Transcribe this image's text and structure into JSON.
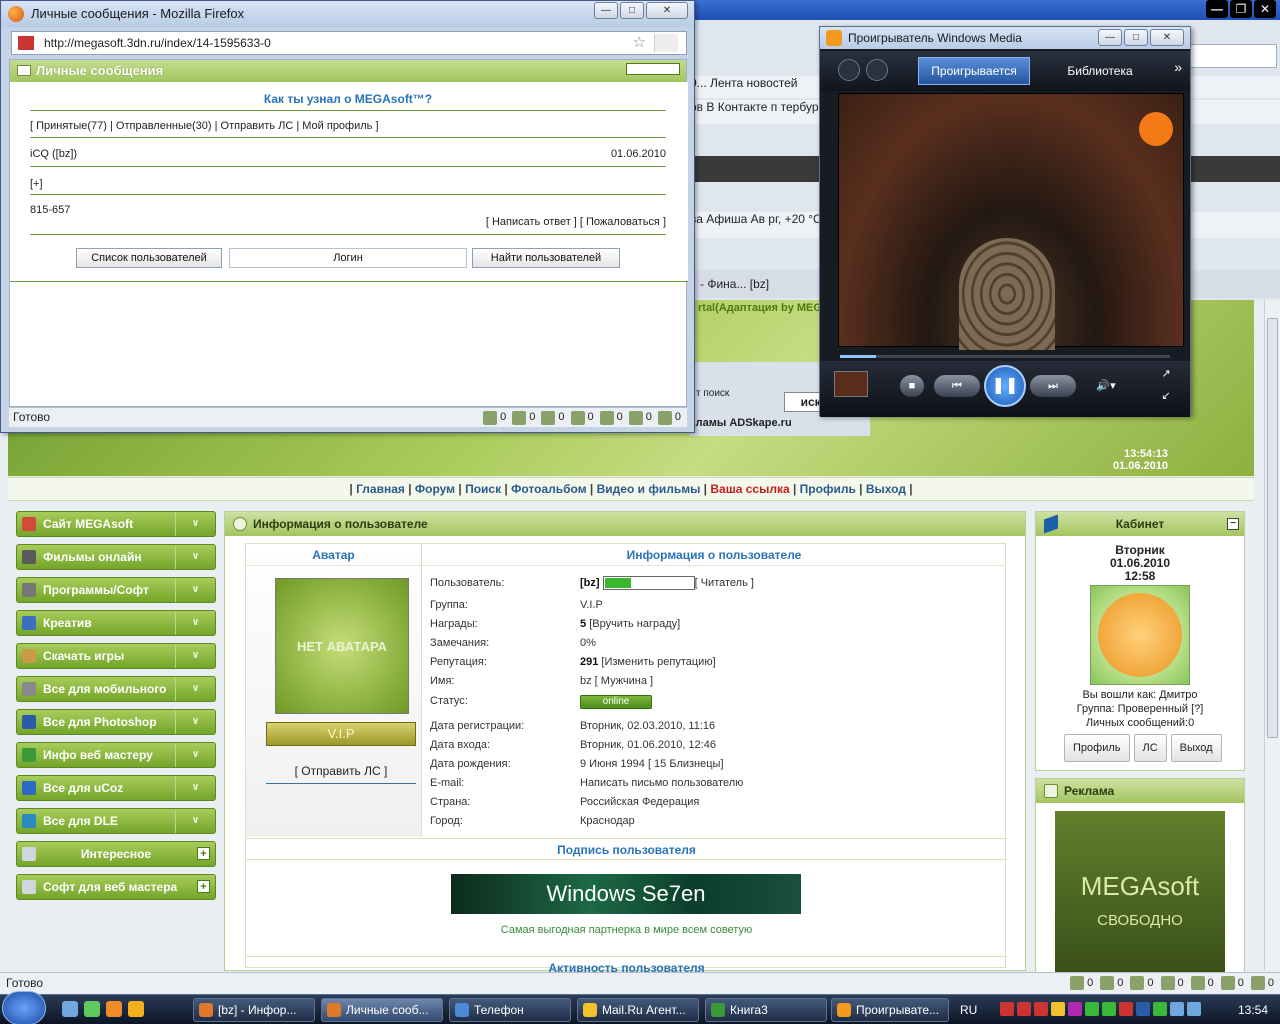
{
  "background_browser": {
    "bookmarks_row1": "0... Лента новостей",
    "bookmarks_row2": "ов  В Контакте   п                                                           тербург  +20",
    "bookmarks_row3": "ва  Афиша  Ав                                                            рг, +20 °C",
    "tab_label": "- Фина...  [bz]",
    "site_tagline": "rtal(Адаптация by MEG",
    "search_label": "т поиск",
    "search_button": "иска",
    "ad_label": "кламы ADSkape.ru",
    "clock_time": "13:54:13",
    "clock_date": "01.06.2010",
    "status": "Готово",
    "status_counts": [
      "0",
      "0",
      "0",
      "0",
      "0",
      "0",
      "0"
    ]
  },
  "nav": {
    "items": [
      "Главная",
      "Форум",
      "Поиск",
      "Фотоальбом",
      "Видео и фильмы",
      "Ваша ссылка",
      "Профиль",
      "Выход"
    ]
  },
  "left_menu": [
    {
      "label": "Сайт MEGAsoft",
      "color": "#d44a3a"
    },
    {
      "label": "Фильмы онлайн",
      "color": "#5a5a5a"
    },
    {
      "label": "Программы/Софт",
      "color": "#777777"
    },
    {
      "label": "Креатив",
      "color": "#3a6fc2"
    },
    {
      "label": "Скачать игры",
      "color": "#c89b47"
    },
    {
      "label": "Все для мобильного",
      "color": "#8a8a8a"
    },
    {
      "label": "Все для Photoshop",
      "color": "#2a5da8"
    },
    {
      "label": "Инфо веб мастеру",
      "color": "#3a9a3a"
    },
    {
      "label": "Все для uCoz",
      "color": "#2a6ac2"
    },
    {
      "label": "Все для DLE",
      "color": "#2a8ac2"
    }
  ],
  "left_menu_expand": [
    {
      "label": "Интересное"
    },
    {
      "label": "Софт для веб мастера"
    }
  ],
  "profile": {
    "panel_title": "Информация о пользователе",
    "avatar_title": "Аватар",
    "info_title": "Информация о пользователе",
    "avatar_text": "НЕТ АВАТАРА",
    "vip_badge": "V.I.P",
    "send_pm": "[ Отправить ЛС ]",
    "rows": [
      {
        "k": "Пользователь:",
        "v": "[bz]",
        "extra": "[ Читатель ]",
        "reputation_fill": 0.3
      },
      {
        "k": "Группа:",
        "v": "V.I.P"
      },
      {
        "k": "Награды:",
        "v": "5",
        "extra": "[Вручить награду]"
      },
      {
        "k": "Замечания:",
        "v": "0%"
      },
      {
        "k": "Репутация:",
        "v": "291",
        "extra": "[Изменить репутацию]"
      },
      {
        "k": "Имя:",
        "v": "bz [ Мужчина ]"
      },
      {
        "k": "Статус:",
        "v": "online"
      },
      {
        "k": "Дата регистрации:",
        "v": "Вторник, 02.03.2010, 11:16"
      },
      {
        "k": "Дата входа:",
        "v": "Вторник, 01.06.2010, 12:46"
      },
      {
        "k": "Дата рождения:",
        "v": "9 Июня 1994 [ 15 Близнецы]"
      },
      {
        "k": "E-mail:",
        "v": "Написать письмо пользователю"
      },
      {
        "k": "Страна:",
        "v": "Российская Федерация"
      },
      {
        "k": "Город:",
        "v": "Краснодар"
      }
    ],
    "signature_title": "Подпись пользователя",
    "signature_banner": "Windows Se7en",
    "signature_text": "Самая выгодная партнерка в мире всем советую",
    "activity_title": "Активность пользователя"
  },
  "cabinet": {
    "title": "Кабинет",
    "day": "Вторник",
    "date": "01.06.2010",
    "time": "12:58",
    "logged_as": "Вы вошли как: Дмитро",
    "group": "Группа: Проверенный  [?]",
    "messages": "Личных сообщений:0",
    "buttons": [
      "Профиль",
      "ЛС",
      "Выход"
    ]
  },
  "ads": {
    "title": "Реклама",
    "brand": "MEGAsoft",
    "slogan": "СВОБОДНО"
  },
  "firefox_popup": {
    "title": "Личные сообщения - Mozilla Firefox",
    "url": "http://megasoft.3dn.ru/index/14-1595633-0",
    "panel_title": "Личные сообщения",
    "subject": "Как ты узнал о MEGAsoft™?",
    "links": "[ Принятые(77) | Отправленные(30) | Отправить ЛС | Мой профиль ]",
    "sender": "iCQ   ([bz])",
    "date": "01.06.2010",
    "expand": "[+]",
    "message": "815-657",
    "actions": "[ Написать ответ ] [ Пожаловаться ]",
    "btn_users": "Список пользователей",
    "login_placeholder": "Логин",
    "btn_find": "Найти пользователей",
    "status": "Готово",
    "status_counts": [
      "0",
      "0",
      "0",
      "0",
      "0",
      "0",
      "0"
    ]
  },
  "wmp": {
    "title": "Проигрыватель Windows Media",
    "tab_playing": "Проигрывается",
    "tab_library": "Библиотека",
    "progress": 0.11
  },
  "taskbar": {
    "tasks": [
      {
        "label": "[bz] - Инфор...",
        "color": "#e07a2a"
      },
      {
        "label": "Личные сооб...",
        "color": "#e07a2a"
      },
      {
        "label": "Телефон",
        "color": "#4a8ad8"
      },
      {
        "label": "Mail.Ru Агент...",
        "color": "#f2c12e"
      },
      {
        "label": "Книга3",
        "color": "#3a9a3a"
      },
      {
        "label": "Проигрывате...",
        "color": "#f29a1e"
      }
    ],
    "lang": "RU",
    "clock": "13:54"
  }
}
